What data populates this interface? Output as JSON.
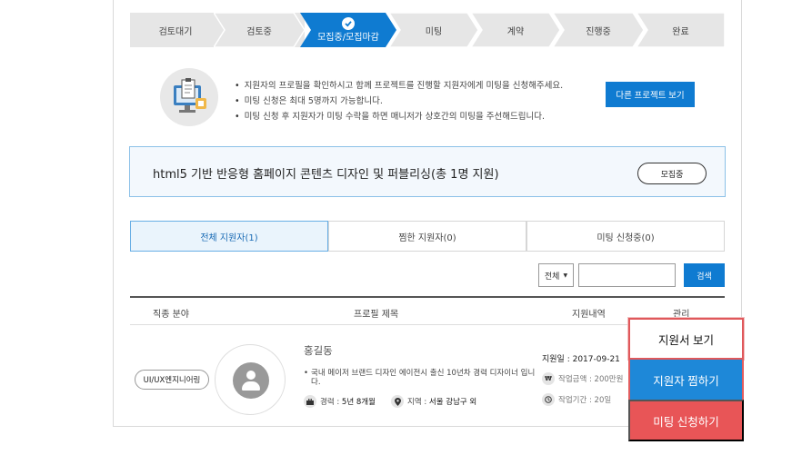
{
  "steps": [
    {
      "label": "검토대기",
      "active": false
    },
    {
      "label": "검토중",
      "active": false
    },
    {
      "label": "모집중/모집마감",
      "active": true
    },
    {
      "label": "미팅",
      "active": false
    },
    {
      "label": "계약",
      "active": false
    },
    {
      "label": "진행중",
      "active": false
    },
    {
      "label": "완료",
      "active": false
    }
  ],
  "info": {
    "icon": "computer-checklist-icon",
    "lines": [
      "지원자의 프로필을 확인하시고 함께 프로젝트를 진행할 지원자에게 미팅을 신청해주세요.",
      "미팅 신청은 최대 5명까지 가능합니다.",
      "미팅 신청 후 지원자가 미팅 수락을 하면 매니저가 상호간의 미팅을 주선해드립니다."
    ],
    "other_button": "다른 프로젝트 보기"
  },
  "project": {
    "title": "html5 기반 반응형 홈페이지 콘텐츠 디자인 및 퍼블리싱(총 1명 지원)",
    "status": "모집중"
  },
  "tabs": [
    {
      "label": "전체 지원자(1)",
      "active": true
    },
    {
      "label": "찜한 지원자(0)",
      "active": false
    },
    {
      "label": "미팅 신청중(0)",
      "active": false
    }
  ],
  "search": {
    "filter_value": "전체",
    "input_value": "",
    "button": "검색"
  },
  "table": {
    "headers": [
      "직종 분야",
      "프로필 제목",
      "지원내역",
      "관리"
    ]
  },
  "applicant": {
    "field": "UI/UX엔지니어링",
    "name": "홍길동",
    "description": "국내 메이저 브랜드 디자인 에이전시 출신 10년차 경력 디자이너 입니다.",
    "career_label": "경력 :",
    "career_value": "5년 8개월",
    "region_label": "지역 :",
    "region_value": "서울 강남구 외",
    "apply_date": "지원일 : 2017-09-21",
    "amount": "작업금액 : 200만원",
    "period": "작업기간 : 20일"
  },
  "actions": {
    "view": "지원서 보기",
    "pick": "지원자 찜하기",
    "meet": "미팅 신청하기"
  },
  "colors": {
    "accent": "#0f7bd1",
    "step_inactive": "#e6e6e6",
    "danger": "#e85557"
  }
}
